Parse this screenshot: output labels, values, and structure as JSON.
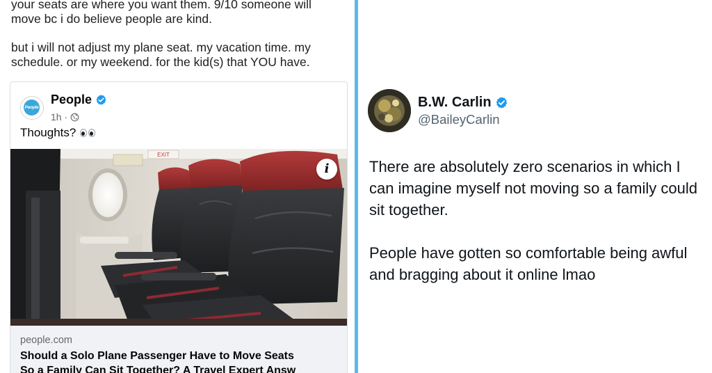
{
  "left_post": {
    "paragraph_1_line_1": "your seats are where you want them. 9/10 someone will",
    "paragraph_1_line_2": "move bc i do believe people are kind.",
    "paragraph_2_line_1": "but i will not adjust my plane seat. my vacation time. my",
    "paragraph_2_line_2": "schedule. or my weekend. for the kid(s) that YOU have."
  },
  "shared_card": {
    "page_name": "People",
    "avatar_text": "People",
    "time": "1h ·",
    "caption": "Thoughts?",
    "info_label": "i",
    "link_domain": "people.com",
    "link_title": "Should a Solo Plane Passenger Have to Move Seats\nSo a Family Can Sit Together? A Travel Expert Answ",
    "exit_sign": "EXIT"
  },
  "tweet": {
    "author_name": "B.W. Carlin",
    "author_handle": "@BaileyCarlin",
    "paragraph_1_line_1": "There are absolutely zero scenarios in which I",
    "paragraph_1_line_2": "can imagine myself not moving so a family could",
    "paragraph_1_line_3": "sit together.",
    "paragraph_2_line_1": "People have gotten so comfortable being awful",
    "paragraph_2_line_2": "and bragging about it online lmao"
  },
  "colors": {
    "divider": "#5db8ea",
    "verified": "#1d9bf0",
    "seat_headrest": "#9c2a2a",
    "seat_leather": "#2a2b2d"
  },
  "icons": {
    "verified": "verified-badge-icon",
    "globe": "globe-icon",
    "eyes": "eyes-emoji-icon",
    "info": "info-icon"
  }
}
